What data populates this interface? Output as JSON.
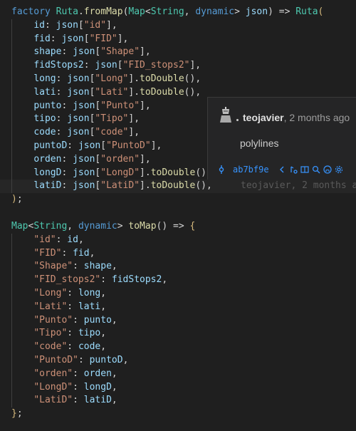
{
  "blame": {
    "author": "teojavier",
    "age": ", 2 months ago",
    "message": "polylines",
    "commit_hash": "ab7bf9e",
    "inline_text": "teojavier, 2 months a"
  },
  "icons": [
    "git-commit-icon",
    "chevron-left-icon",
    "chevron-right-icon",
    "compare-icon",
    "search-icon",
    "github-icon",
    "settings-icon"
  ]
}
